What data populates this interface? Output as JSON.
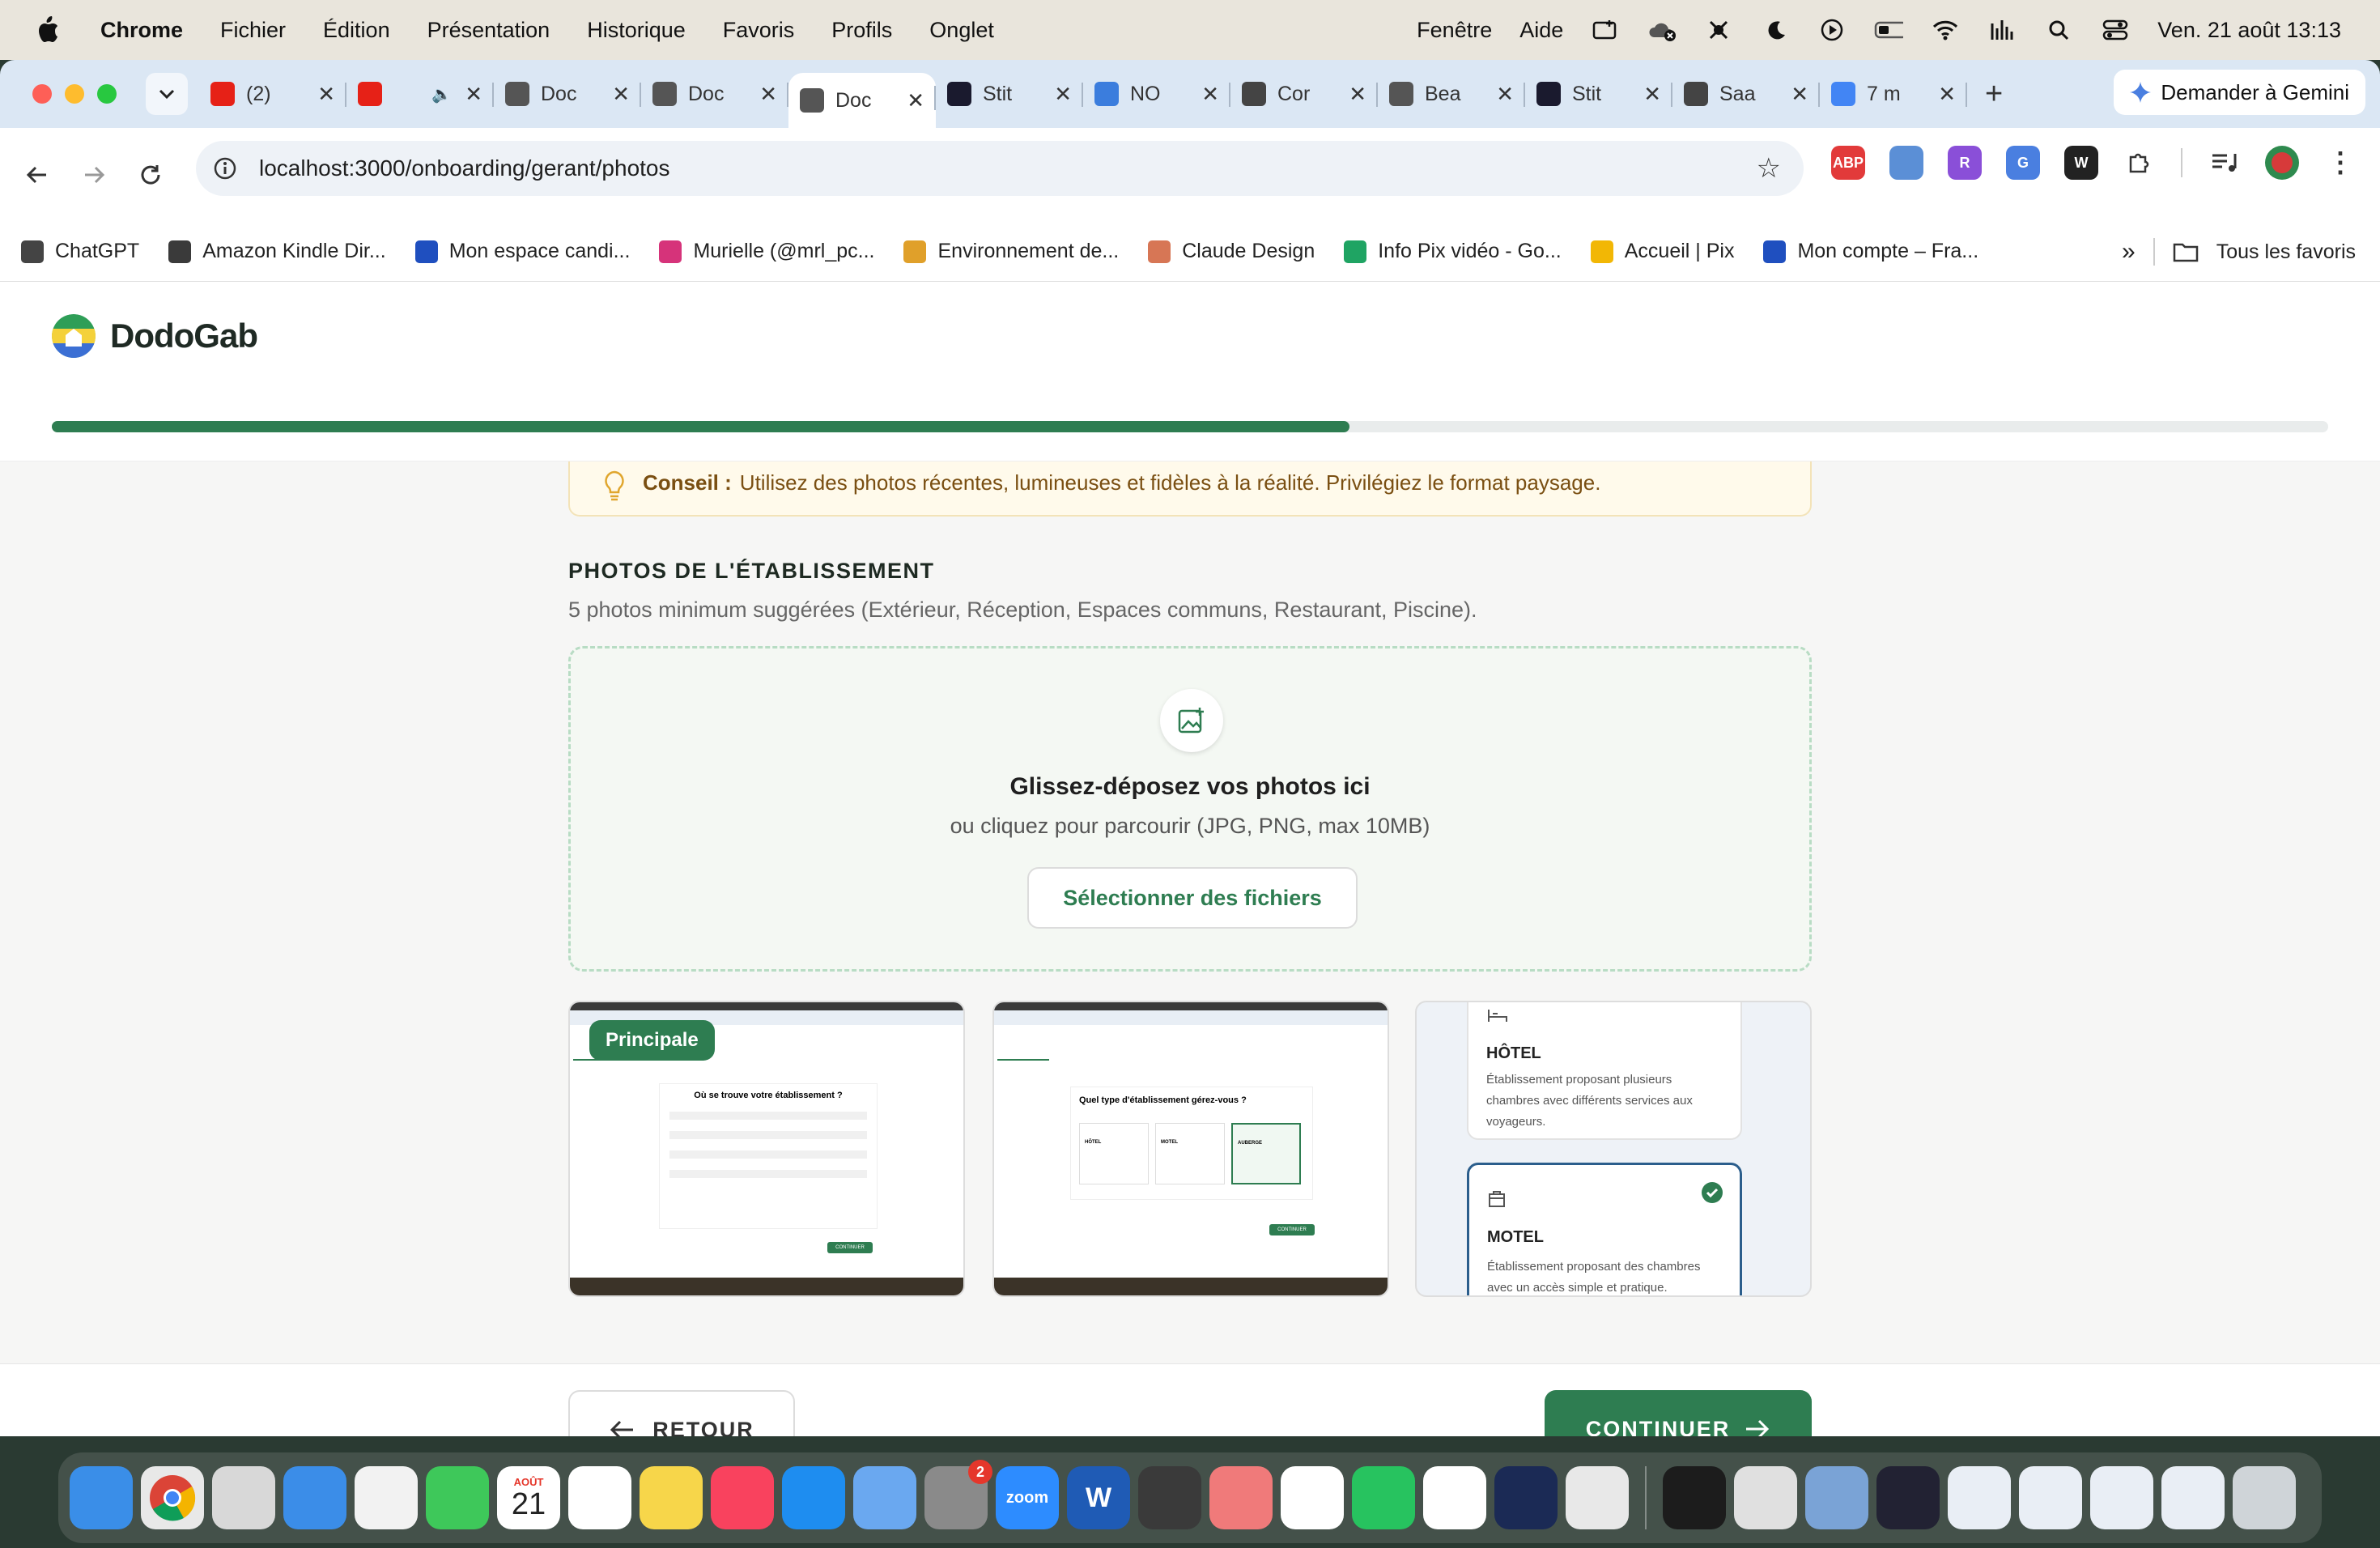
{
  "menubar": {
    "app": "Chrome",
    "items": [
      "Fichier",
      "Édition",
      "Présentation",
      "Historique",
      "Favoris",
      "Profils",
      "Onglet"
    ],
    "right_items": [
      "Fenêtre",
      "Aide"
    ],
    "datetime": "Ven. 21 août  13:13"
  },
  "tabs": [
    {
      "label": "(2)",
      "icon": "youtube-icon",
      "color": "#e62117"
    },
    {
      "label": "",
      "icon": "youtube-icon",
      "color": "#e62117"
    },
    {
      "label": "Doc",
      "icon": "globe-icon",
      "color": "#555555"
    },
    {
      "label": "Doc",
      "icon": "globe-icon",
      "color": "#555555"
    },
    {
      "label": "Doc",
      "icon": "globe-icon",
      "color": "#555555"
    },
    {
      "label": "Stit",
      "icon": "stitch-icon",
      "color": "#1a1a2e"
    },
    {
      "label": "NO",
      "icon": "docs-icon",
      "color": "#3b7ddd"
    },
    {
      "label": "Cor",
      "icon": "openai-icon",
      "color": "#444444"
    },
    {
      "label": "Bea",
      "icon": "globe-icon",
      "color": "#555555"
    },
    {
      "label": "Stit",
      "icon": "stitch-icon",
      "color": "#1a1a2e"
    },
    {
      "label": "Saa",
      "icon": "openai-icon",
      "color": "#444444"
    },
    {
      "label": "7 m",
      "icon": "google-icon",
      "color": "#4285f4"
    }
  ],
  "active_tab_index": 4,
  "gemini_label": "Demander à Gemini",
  "url": "localhost:3000/onboarding/gerant/photos",
  "extensions": [
    {
      "label": "ABP",
      "color": "#e23a3a"
    },
    {
      "label": "",
      "color": "#5b8fd6"
    },
    {
      "label": "R",
      "color": "#8a4fd8"
    },
    {
      "label": "G",
      "color": "#4a7fe0"
    },
    {
      "label": "W",
      "color": "#222222"
    }
  ],
  "bookmarks": [
    {
      "label": "ChatGPT",
      "color": "#444444"
    },
    {
      "label": "Amazon Kindle Dir...",
      "color": "#3a3a3a"
    },
    {
      "label": "Mon espace candi...",
      "color": "#1f4fbf"
    },
    {
      "label": "Murielle (@mrl_pc...",
      "color": "#d6337a"
    },
    {
      "label": "Environnement de...",
      "color": "#e0a02a"
    },
    {
      "label": "Claude Design",
      "color": "#d77655"
    },
    {
      "label": "Info Pix vidéo - Go...",
      "color": "#1fa463"
    },
    {
      "label": "Accueil | Pix",
      "color": "#f2b705"
    },
    {
      "label": "Mon compte – Fra...",
      "color": "#1f4fbf"
    }
  ],
  "bookmarks_more": "»",
  "all_bookmarks": "Tous les favoris",
  "app": {
    "name": "DodoGab",
    "progress": 0.57,
    "tip_label": "Conseil :",
    "tip_text": "Utilisez des photos récentes, lumineuses et fidèles à la réalité. Privilégiez le format paysage.",
    "section_title": "PHOTOS DE L'ÉTABLISSEMENT",
    "section_subtitle": "5 photos minimum suggérées (Extérieur, Réception, Espaces communs, Restaurant, Piscine).",
    "drop_title": "Glissez-déposez vos photos ici",
    "drop_subtitle": "ou cliquez pour parcourir (JPG, PNG, max 10MB)",
    "select_button": "Sélectionner des fichiers",
    "photos": [
      {
        "badge": "Principale",
        "heading": "Où se trouve votre établissement ?",
        "button": "CONTINUER"
      },
      {
        "heading": "Quel type d'établissement gérez-vous ?",
        "options": [
          "HÔTEL",
          "MOTEL",
          "AUBERGE"
        ],
        "button": "CONTINUER"
      },
      {
        "card1_title": "HÔTEL",
        "card1_text": "Établissement proposant plusieurs chambres avec différents services aux voyageurs.",
        "card2_title": "MOTEL",
        "card2_text": "Établissement proposant des chambres avec un accès simple et pratique."
      }
    ],
    "back_button": "RETOUR",
    "continue_button": "CONTINUER"
  },
  "dock": {
    "calendar_month": "AOÛT",
    "calendar_day": "21",
    "settings_badge": "2",
    "zoom_label": "zoom",
    "word_label": "W",
    "apps": [
      {
        "name": "finder-icon",
        "color": "#3a8ee8"
      },
      {
        "name": "chrome-icon",
        "color": "#e8e8e8"
      },
      {
        "name": "launchpad-icon",
        "color": "#d8d8d8"
      },
      {
        "name": "safari-icon",
        "color": "#3b8de8"
      },
      {
        "name": "photos-icon",
        "color": "#f2f2f2"
      },
      {
        "name": "facetime-icon",
        "color": "#3ec85a"
      },
      {
        "name": "calendar-icon",
        "color": "#ffffff"
      },
      {
        "name": "reminders-icon",
        "color": "#ffffff"
      },
      {
        "name": "notes-icon",
        "color": "#f7d64a"
      },
      {
        "name": "music-icon",
        "color": "#f9425e"
      },
      {
        "name": "appstore-icon",
        "color": "#1e8df0"
      },
      {
        "name": "swift-icon",
        "color": "#6aa8f0"
      },
      {
        "name": "settings-icon",
        "color": "#8a8a8a"
      },
      {
        "name": "zoom-icon",
        "color": "#2d8cff"
      },
      {
        "name": "word-icon",
        "color": "#1f5bb5"
      },
      {
        "name": "calculator-icon",
        "color": "#3a3a3a"
      },
      {
        "name": "todo-icon",
        "color": "#f07a7a"
      },
      {
        "name": "capcut-icon",
        "color": "#ffffff"
      },
      {
        "name": "whatsapp-icon",
        "color": "#27c35f"
      },
      {
        "name": "drive-icon",
        "color": "#ffffff"
      },
      {
        "name": "arc-icon",
        "color": "#1b2a55"
      },
      {
        "name": "iphone-mirror-icon",
        "color": "#e8e8e8"
      }
    ],
    "apps_right": [
      {
        "name": "terminal-icon",
        "color": "#1c1c1c"
      },
      {
        "name": "preview-icon",
        "color": "#e0e0e0"
      },
      {
        "name": "mail-icon",
        "color": "#7aa3d6"
      },
      {
        "name": "istat-icon",
        "color": "#222233"
      },
      {
        "name": "folder-stack-icon",
        "color": "#e9eef5"
      },
      {
        "name": "folder-stack-icon",
        "color": "#e9eef5"
      },
      {
        "name": "folder-stack-icon",
        "color": "#e9eef5"
      },
      {
        "name": "folder-stack-icon",
        "color": "#e9eef5"
      },
      {
        "name": "trash-icon",
        "color": "#cfd4d8"
      }
    ]
  }
}
